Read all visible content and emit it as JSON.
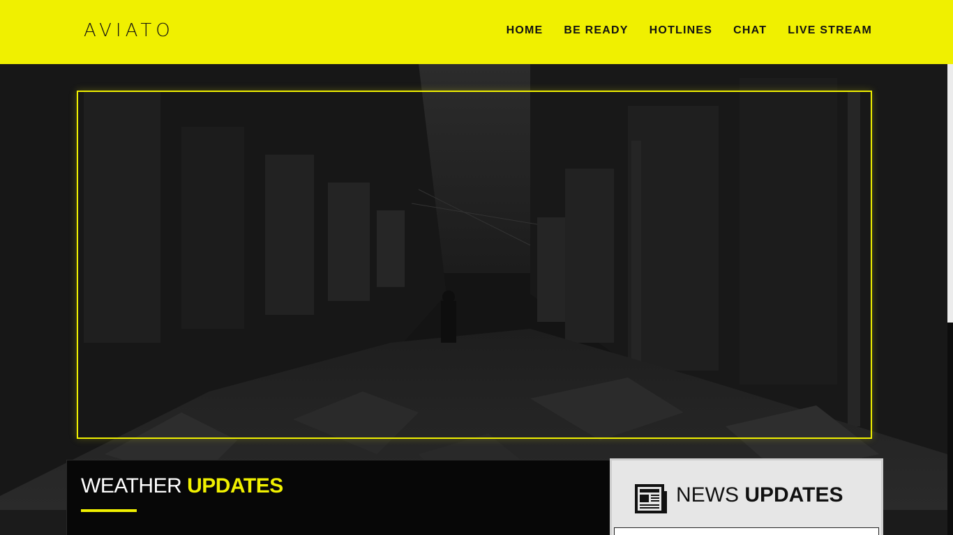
{
  "brand": {
    "logo_text": "AVIATO"
  },
  "nav": {
    "items": [
      {
        "label": "HOME"
      },
      {
        "label": "BE READY"
      },
      {
        "label": "HOTLINES"
      },
      {
        "label": "CHAT"
      },
      {
        "label": "LIVE STREAM"
      }
    ]
  },
  "weather": {
    "title_light": "WEATHER ",
    "title_bold": "UPDATES"
  },
  "news": {
    "title_light": "NEWS ",
    "title_bold": "UPDATES",
    "icon": "newspaper-icon"
  },
  "colors": {
    "accent": "#f0f000",
    "dark": "#0a0a0a",
    "panel_light": "#e6e6e6"
  }
}
